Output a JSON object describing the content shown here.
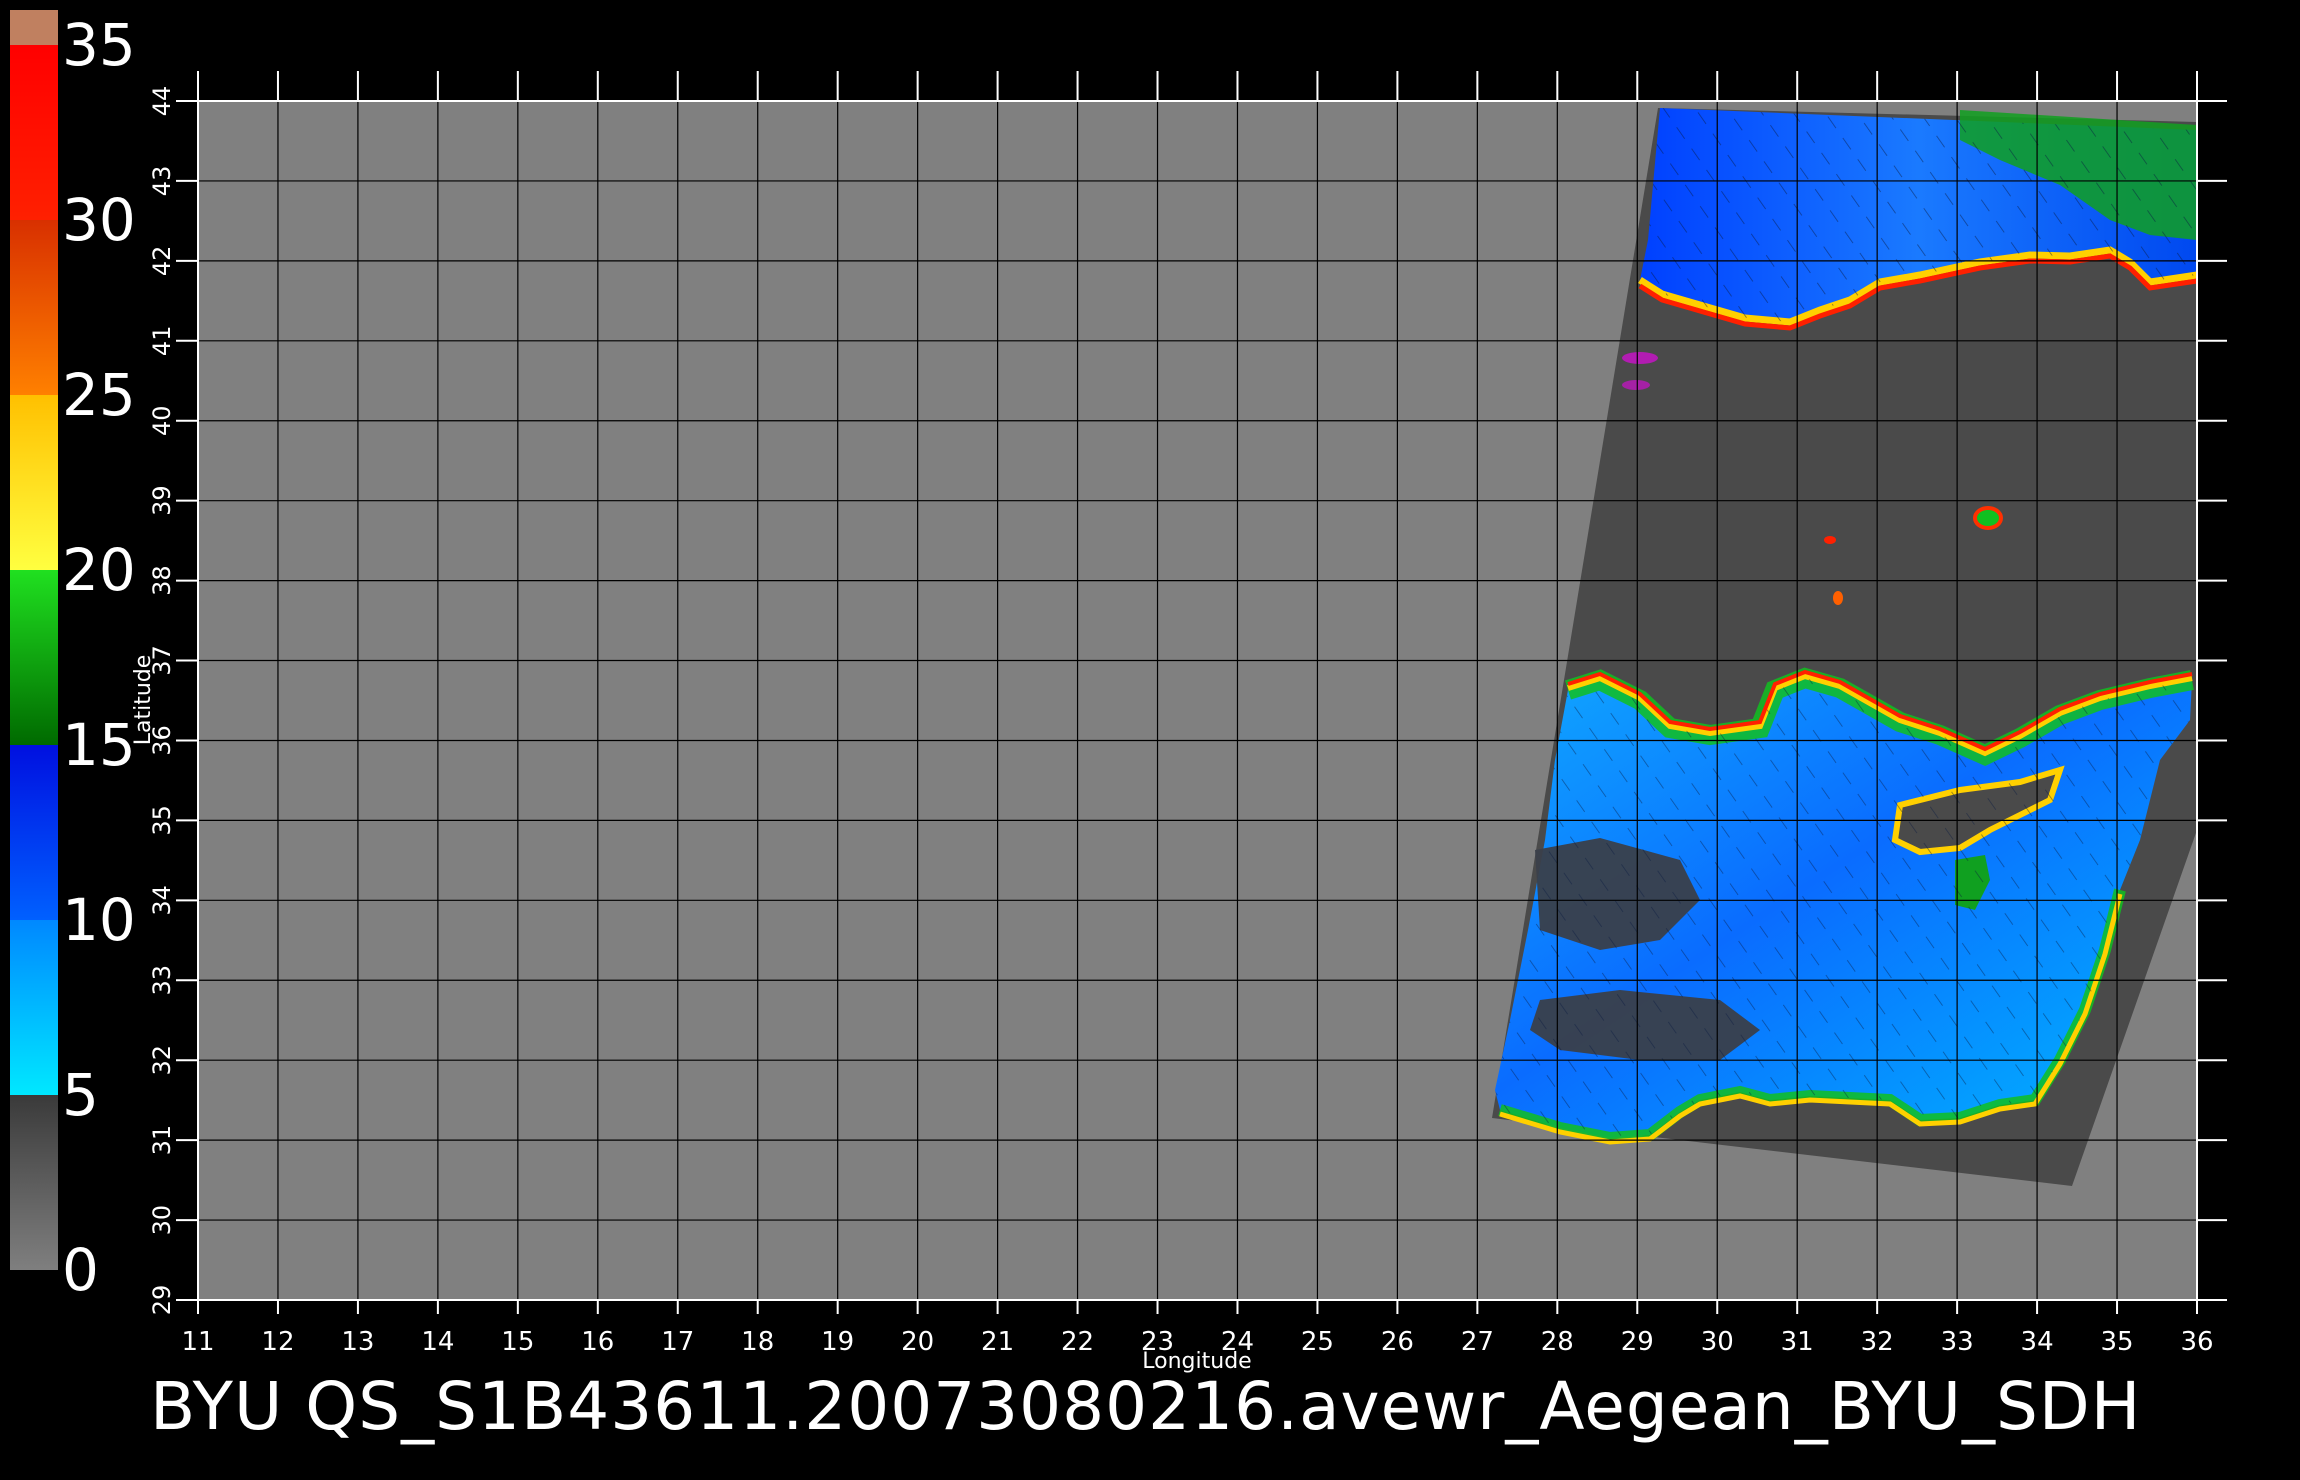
{
  "colorbar": {
    "ticks": [
      "0",
      "5",
      "10",
      "15",
      "20",
      "25",
      "30",
      "35"
    ],
    "bands": [
      {
        "from": 0,
        "to": 5,
        "colors": [
          "#7f7f7f",
          "#3a3a3a"
        ]
      },
      {
        "from": 5,
        "to": 10,
        "colors": [
          "#00e8ff",
          "#0088ff"
        ]
      },
      {
        "from": 10,
        "to": 15,
        "colors": [
          "#0060ff",
          "#0010e0"
        ]
      },
      {
        "from": 15,
        "to": 20,
        "colors": [
          "#006a00",
          "#20e020"
        ]
      },
      {
        "from": 20,
        "to": 25,
        "colors": [
          "#ffff40",
          "#ffc000"
        ]
      },
      {
        "from": 25,
        "to": 30,
        "colors": [
          "#ff8000",
          "#d83000"
        ]
      },
      {
        "from": 30,
        "to": 35,
        "colors": [
          "#ff2000",
          "#ff0000"
        ]
      },
      {
        "from": 35,
        "to": 36,
        "colors": [
          "#c08060",
          "#c08060"
        ]
      }
    ]
  },
  "map": {
    "lon_range": [
      11,
      36
    ],
    "lat_range": [
      29,
      44
    ],
    "lon_ticks": [
      "11",
      "12",
      "13",
      "14",
      "15",
      "16",
      "17",
      "18",
      "19",
      "20",
      "21",
      "22",
      "23",
      "24",
      "25",
      "26",
      "27",
      "28",
      "29",
      "30",
      "31",
      "32",
      "33",
      "34",
      "35",
      "36"
    ],
    "lat_ticks": [
      "29",
      "30",
      "31",
      "32",
      "33",
      "34",
      "35",
      "36",
      "37",
      "38",
      "39",
      "40",
      "41",
      "42",
      "43",
      "44"
    ],
    "xlabel": "Longitude",
    "ylabel": "Latitude",
    "background_color": "#808080",
    "no_data_color": "#4a4a4a",
    "grid_color": "#000000"
  },
  "caption": "BYU  QS_S1B43611.20073080216.avewr_Aegean_BYU_SDH"
}
